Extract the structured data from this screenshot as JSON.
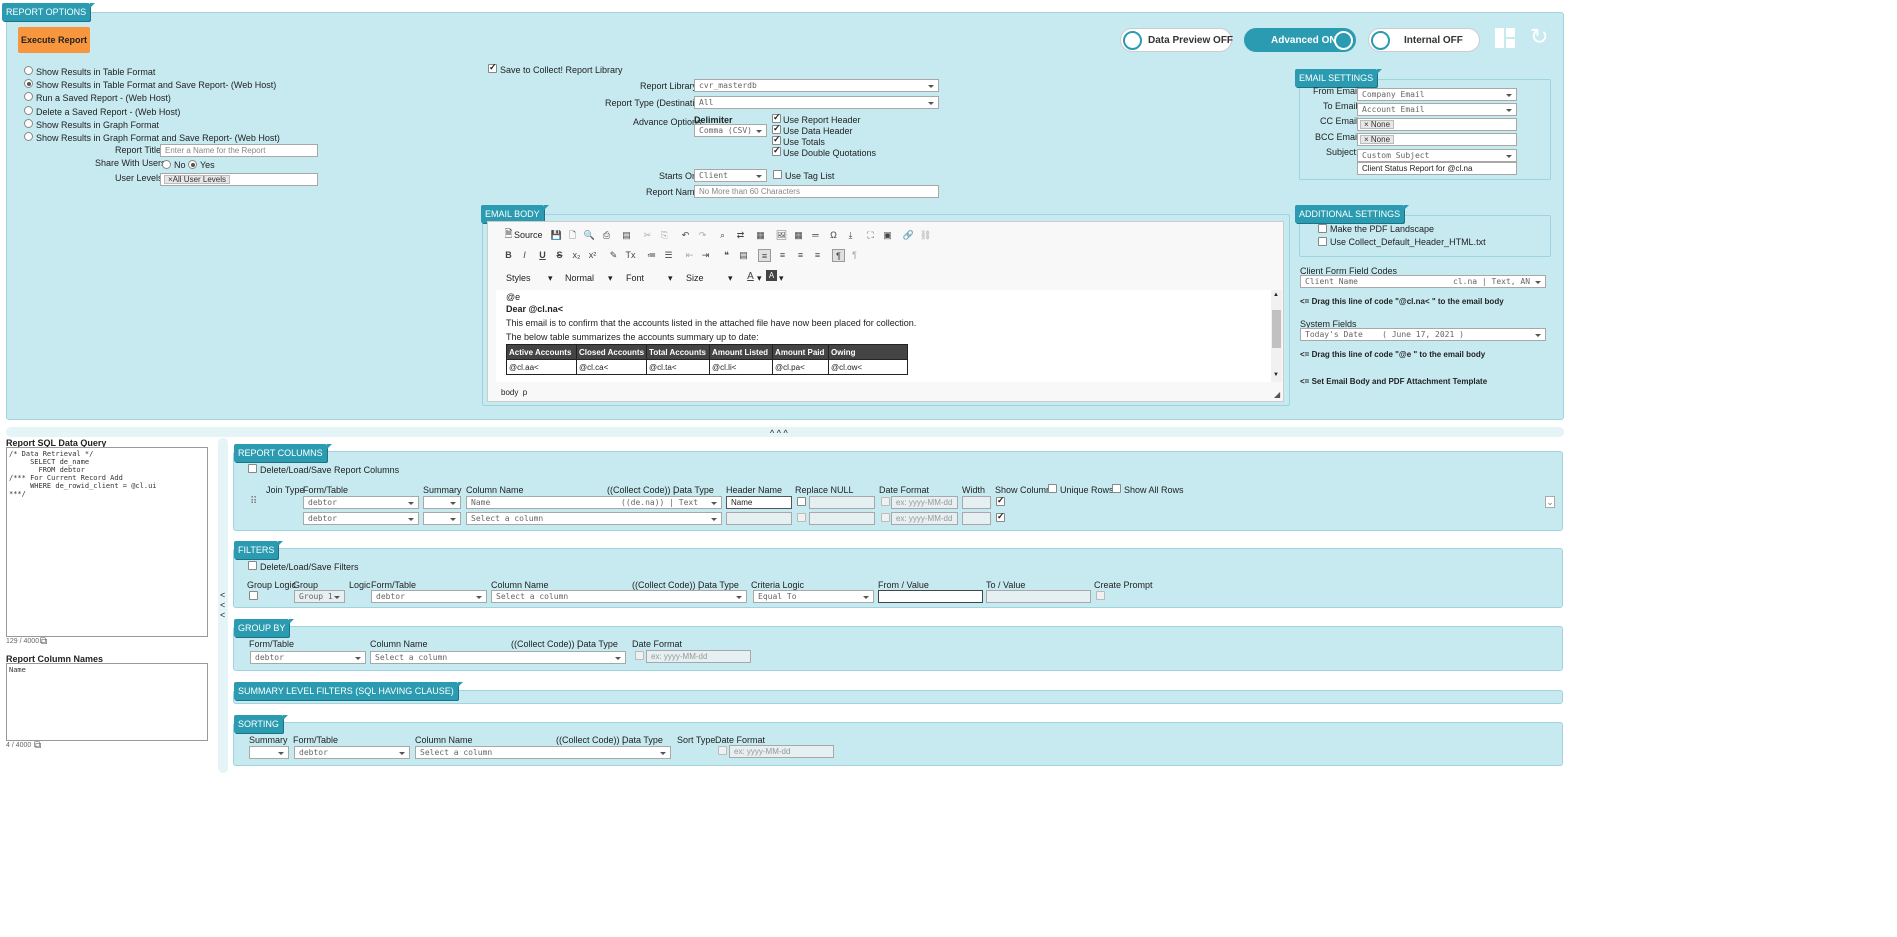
{
  "report_options": {
    "tag": "REPORT OPTIONS",
    "execute_label": "Execute Report",
    "radio_options": [
      {
        "label": "Show Results in Table Format",
        "checked": false
      },
      {
        "label": "Show Results in Table Format and Save Report- (Web Host)",
        "checked": true
      },
      {
        "label": "Run a Saved Report - (Web Host)",
        "checked": false
      },
      {
        "label": "Delete a Saved Report - (Web Host)",
        "checked": false
      },
      {
        "label": "Show Results in Graph Format",
        "checked": false
      },
      {
        "label": "Show Results in Graph Format and Save Report- (Web Host)",
        "checked": false
      }
    ],
    "report_title_label": "Report Title:",
    "report_title_placeholder": "Enter a Name for the Report",
    "share_label": "Share With Users:",
    "share_no": "No",
    "share_yes": "Yes",
    "user_levels_label": "User Levels:",
    "user_levels_chip": "All User Levels",
    "save_library_label": "Save to Collect! Report Library",
    "report_library_label": "Report Library",
    "report_library_value": "cvr_masterdb",
    "report_type_label": "Report Type (Destination)",
    "report_type_value": "All",
    "advance_options_label": "Advance Options",
    "delimiter_label": "Delimiter",
    "delimiter_value": "Comma (CSV)",
    "use_options": [
      "Use Report Header",
      "Use Data Header",
      "Use Totals",
      "Use Double Quotations"
    ],
    "starts_on_label": "Starts On",
    "starts_on_value": "Client",
    "use_tag_list": "Use Tag List",
    "report_name_label": "Report Name",
    "report_name_placeholder": "No More than 60 Characters"
  },
  "toggles": {
    "preview": "Data Preview OFF",
    "advanced": "Advanced ON",
    "internal": "Internal OFF"
  },
  "email_settings": {
    "tag": "EMAIL SETTINGS",
    "from_label": "From Email:",
    "from_value": "Company Email",
    "to_label": "To Email:",
    "to_value": "Account Email",
    "cc_label": "CC Email:",
    "cc_chip": "None",
    "bcc_label": "BCC Email:",
    "bcc_chip": "None",
    "subject_label": "Subject:",
    "subject_value": "Custom Subject",
    "subject_text": "Client Status Report for @cl.na"
  },
  "additional_settings": {
    "tag": "ADDITIONAL SETTINGS",
    "pdf_landscape": "Make the PDF Landscape",
    "default_header": "Use Collect_Default_Header_HTML.txt",
    "client_fields_label": "Client Form Field Codes",
    "client_fields_value": "Client Name",
    "client_fields_code": "cl.na | Text, AN",
    "drag_hint_1": "<= Drag this line of code \"@cl.na< \" to the email body",
    "system_fields_label": "System Fields",
    "system_fields_value": "Today's Date    ( June 17, 2021 )",
    "drag_hint_2": "<= Drag this line of code \"@e \" to the email body",
    "set_template": "<= Set Email Body and PDF Attachment Template"
  },
  "email_body": {
    "tag": "EMAIL BODY",
    "source_label": "Source",
    "styles": "Styles",
    "format": "Normal",
    "font": "Font",
    "size": "Size",
    "line_e": "@e",
    "greeting": "Dear @cl.na<",
    "para1": "This email is to confirm that the accounts listed in the attached file have now been placed for collection.",
    "para2": "The below table summarizes the accounts summary up to date:",
    "table_headers": [
      "Active Accounts",
      "Closed Accounts",
      "Total Accounts",
      "Amount Listed",
      "Amount Paid",
      "Owing"
    ],
    "table_values": [
      "@cl.aa<",
      "@cl.ca<",
      "@cl.ta<",
      "@cl.li<",
      "@cl.pa<",
      "@cl.ow<"
    ],
    "status_path": "body  p"
  },
  "sql": {
    "label": "Report SQL Data Query",
    "text": "/* Data Retrieval */\n     SELECT de_name\n       FROM debtor\n/*** For Current Record Add\n     WHERE de_rowid_client = @cl.ui\n***/",
    "count": "129 / 4000",
    "names_label": "Report Column Names",
    "names_text": "Name",
    "names_count": "4 / 4000"
  },
  "report_columns": {
    "tag": "REPORT COLUMNS",
    "delete_load": "Delete/Load/Save Report Columns",
    "headers": {
      "join": "Join Type",
      "form": "Form/Table",
      "summary": "Summary",
      "column": "Column Name",
      "code": "((Collect Code)) |",
      "dtype": "Data Type",
      "header": "Header Name",
      "replace": "Replace NULL",
      "date": "Date Format",
      "width": "Width",
      "show": "Show Column",
      "unique": "Unique Rows",
      "showall": "Show All Rows"
    },
    "row1": {
      "form": "debtor",
      "column": "Name",
      "code": "((de.na)) | Text",
      "header": "Name",
      "date_ph": "ex: yyyy-MM-dd"
    },
    "row2": {
      "form": "debtor",
      "column": "Select a column",
      "date_ph": "ex: yyyy-MM-dd"
    }
  },
  "filters": {
    "tag": "FILTERS",
    "delete_load": "Delete/Load/Save Filters",
    "headers": {
      "glogic": "Group Logic",
      "group": "Group",
      "logic": "Logic",
      "form": "Form/Table",
      "column": "Column Name",
      "code": "((Collect Code)) |",
      "dtype": "Data Type",
      "criteria": "Criteria Logic",
      "from": "From / Value",
      "to": "To / Value",
      "prompt": "Create Prompt"
    },
    "group_value": "Group 1",
    "form_value": "debtor",
    "column_value": "Select a column",
    "criteria_value": "Equal To"
  },
  "group_by": {
    "tag": "GROUP BY",
    "headers": {
      "form": "Form/Table",
      "column": "Column Name",
      "code": "((Collect Code)) |",
      "dtype": "Data Type",
      "date": "Date Format"
    },
    "form_value": "debtor",
    "column_value": "Select a column",
    "date_ph": "ex: yyyy-MM-dd"
  },
  "summary_filters": {
    "tag": "SUMMARY LEVEL FILTERS (SQL HAVING CLAUSE)"
  },
  "sorting": {
    "tag": "SORTING",
    "headers": {
      "summary": "Summary",
      "form": "Form/Table",
      "column": "Column Name",
      "code": "((Collect Code)) |",
      "dtype": "Data Type",
      "sort": "Sort Type",
      "date": "Date Format"
    },
    "form_value": "debtor",
    "column_value": "Select a column",
    "date_ph": "ex: yyyy-MM-dd"
  },
  "collapse_arrows": "^ ^ ^",
  "side_arrows": [
    "<",
    "<",
    "<"
  ]
}
